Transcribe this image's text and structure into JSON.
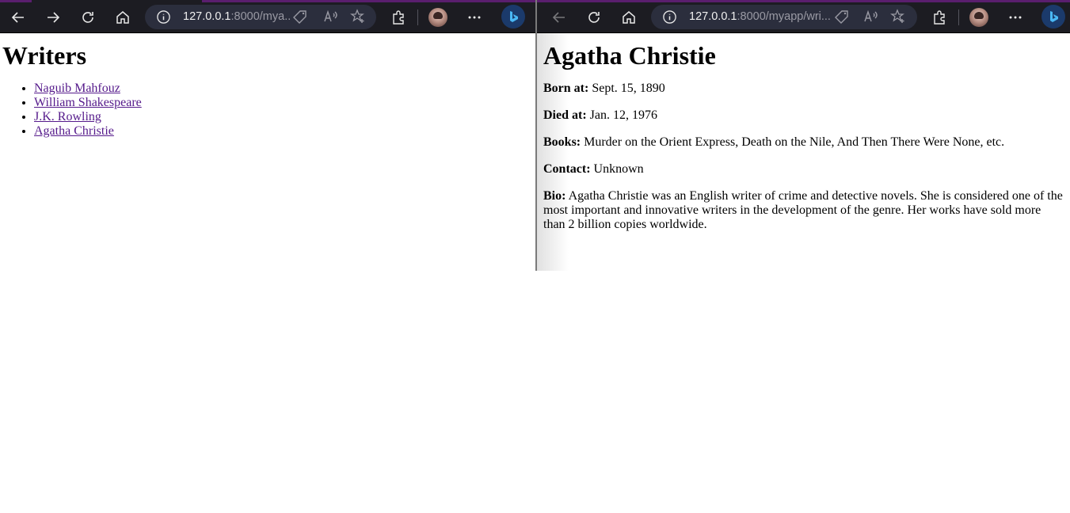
{
  "left_window": {
    "address": {
      "host": "127.0.0.1",
      "rest": ":8000/mya..."
    },
    "page_title": "Writers",
    "writers": [
      "Naguib Mahfouz",
      "William Shakespeare",
      "J.K. Rowling",
      "Agatha Christie"
    ]
  },
  "right_window": {
    "address": {
      "host": "127.0.0.1",
      "rest": ":8000/myapp/wri..."
    },
    "page_title": "Agatha Christie",
    "fields": [
      {
        "label": "Born at:",
        "value": "Sept. 15, 1890"
      },
      {
        "label": "Died at:",
        "value": "Jan. 12, 1976"
      },
      {
        "label": "Books:",
        "value": "Murder on the Orient Express, Death on the Nile, And Then There Were None, etc."
      },
      {
        "label": "Contact:",
        "value": "Unknown"
      },
      {
        "label": "Bio:",
        "value": "Agatha Christie was an English writer of crime and detective novels. She is considered one of the most important and innovative writers in the development of the genre. Her works have sold more than 2 billion copies worldwide."
      }
    ]
  },
  "colors": {
    "toolbar_bg": "#1c1c22",
    "address_bg": "#2b2e3d",
    "visited_link": "#551a8b",
    "accent": "#5a1e6e"
  }
}
